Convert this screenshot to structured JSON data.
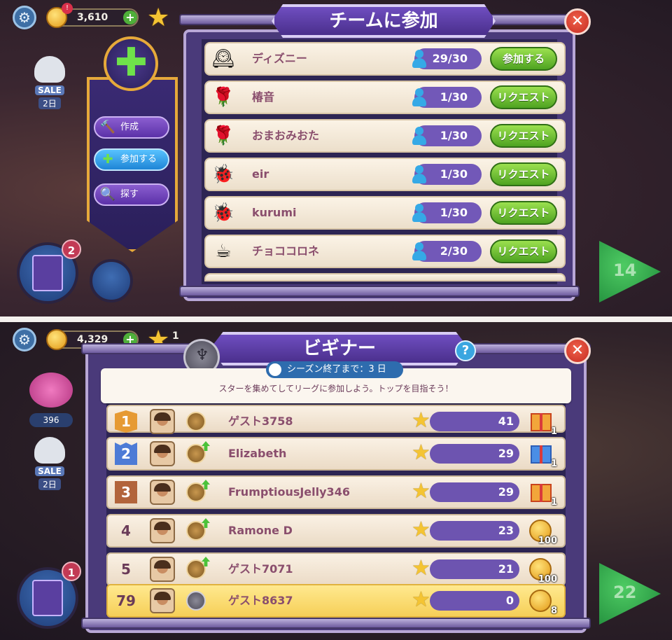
{
  "top_screen": {
    "hud": {
      "coins": "3,610",
      "notification_badge": "!",
      "sale_label": "SALE",
      "sale_days": "2日",
      "book_badge": "2",
      "level_number": "14"
    },
    "side_menu": {
      "items": [
        {
          "label": "作成",
          "icon": "hammer-icon"
        },
        {
          "label": "参加する",
          "icon": "plus-icon"
        },
        {
          "label": "探す",
          "icon": "magnifier-icon"
        }
      ],
      "active_index": 1
    },
    "join_dialog": {
      "title": "チームに参加",
      "teams": [
        {
          "name": "ディズニー",
          "members": "29/30",
          "action": "参加する",
          "icon": "cuckoo-clock-icon",
          "glyph": "🕰"
        },
        {
          "name": "椿音",
          "members": "1/30",
          "action": "リクエスト",
          "icon": "rose-icon",
          "glyph": "🌹"
        },
        {
          "name": "おまおみおた",
          "members": "1/30",
          "action": "リクエスト",
          "icon": "rose-icon",
          "glyph": "🌹"
        },
        {
          "name": "eir",
          "members": "1/30",
          "action": "リクエスト",
          "icon": "ladybug-icon",
          "glyph": "🐞"
        },
        {
          "name": "kurumi",
          "members": "1/30",
          "action": "リクエスト",
          "icon": "ladybug-icon",
          "glyph": "🐞"
        },
        {
          "name": "チョココロネ",
          "members": "2/30",
          "action": "リクエスト",
          "icon": "teacup-icon",
          "glyph": "☕"
        }
      ]
    }
  },
  "bottom_screen": {
    "hud": {
      "coins": "4,329",
      "stars_partial": "1",
      "piggy_value": "396",
      "sale_label": "SALE",
      "sale_days": "2日",
      "book_badge": "1",
      "level_number": "22"
    },
    "league_dialog": {
      "title": "ビギナー",
      "help": "?",
      "season_label": "シーズン終了まで：3 日",
      "season_subtitle": "スターを集めてしてリーグに参加しよう。トップを目指そう！",
      "players": [
        {
          "rank": "1",
          "name": "ゲスト3758",
          "score": "41",
          "reward_qty": "1",
          "reward": "gift-orange"
        },
        {
          "rank": "2",
          "name": "Elizabeth",
          "score": "29",
          "reward_qty": "1",
          "reward": "gift-blue"
        },
        {
          "rank": "3",
          "name": "FrumptiousJelly346",
          "score": "29",
          "reward_qty": "1",
          "reward": "gift-orange"
        },
        {
          "rank": "4",
          "name": "Ramone D",
          "score": "23",
          "reward_qty": "100",
          "reward": "coin"
        },
        {
          "rank": "5",
          "name": "ゲスト7071",
          "score": "21",
          "reward_qty": "100",
          "reward": "coin"
        },
        {
          "rank": "79",
          "name": "ゲスト8637",
          "score": "0",
          "reward_qty": "8",
          "reward": "coin"
        }
      ]
    }
  },
  "colors": {
    "dialog_purple": "#4a3a7a",
    "action_green": "#4ea321",
    "close_red": "#c52b22",
    "highlight_row": "#f6cf58"
  }
}
